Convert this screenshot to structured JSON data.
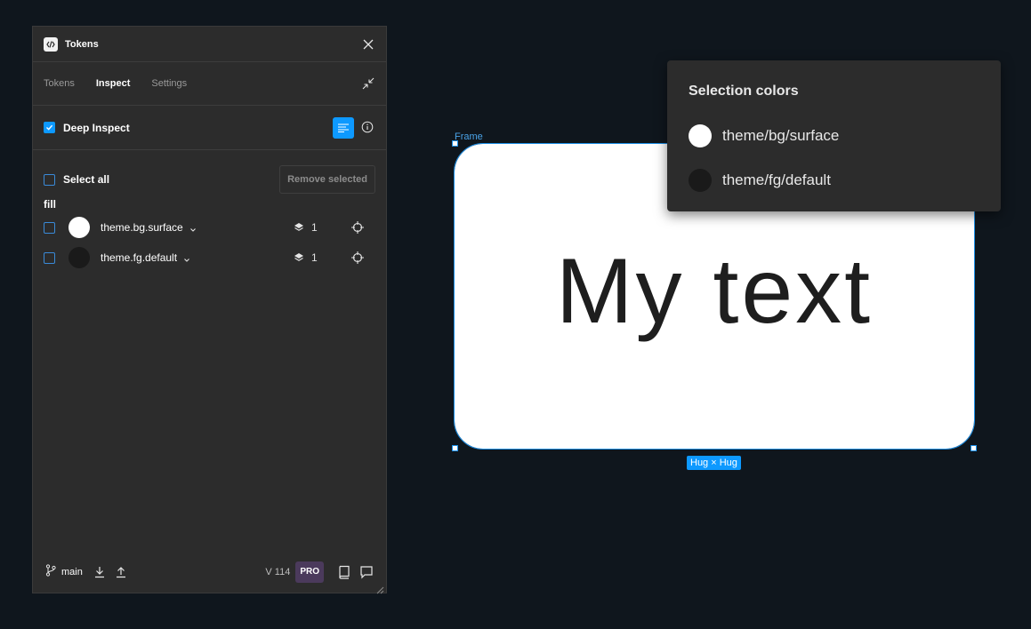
{
  "panel": {
    "title": "Tokens",
    "tabs": [
      {
        "label": "Tokens",
        "active": false
      },
      {
        "label": "Inspect",
        "active": true
      },
      {
        "label": "Settings",
        "active": false
      }
    ],
    "deep_inspect": {
      "label": "Deep Inspect",
      "checked": true
    },
    "select_all_label": "Select all",
    "remove_selected_label": "Remove selected",
    "group_label": "fill",
    "tokens": [
      {
        "name": "theme.bg.surface",
        "color": "#ffffff",
        "count": "1"
      },
      {
        "name": "theme.fg.default",
        "color": "#1a1a1a",
        "count": "1"
      }
    ],
    "footer": {
      "branch": "main",
      "version": "V 114",
      "plan": "PRO"
    }
  },
  "canvas": {
    "frame_label": "Frame",
    "frame_text": "My text",
    "size_badge": "Hug × Hug"
  },
  "selection_colors": {
    "title": "Selection colors",
    "items": [
      {
        "name": "theme/bg/surface",
        "color": "#ffffff"
      },
      {
        "name": "theme/fg/default",
        "color": "#1a1a1a"
      }
    ]
  },
  "colors": {
    "accent": "#0d99ff",
    "panel_bg": "#2c2c2c",
    "canvas_bg": "#0f161d"
  }
}
